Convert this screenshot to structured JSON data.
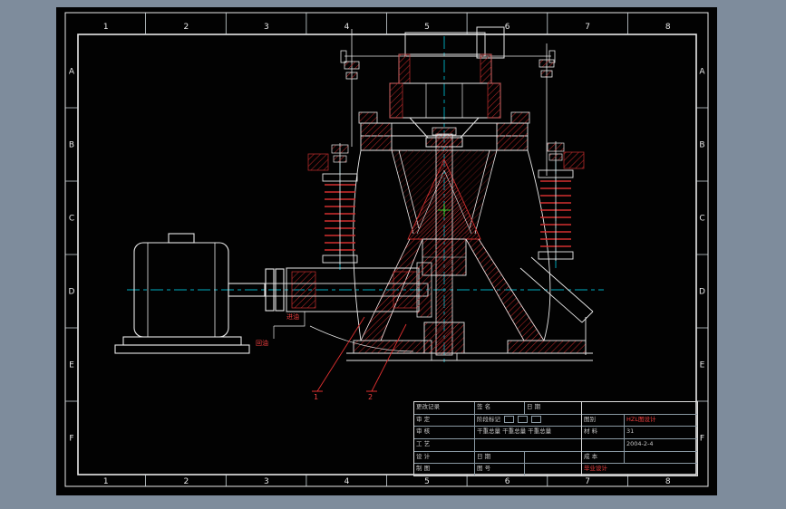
{
  "window": {
    "background": "#7e8c9c",
    "paper_color": "#000000",
    "frame_color": "#e8e8e8",
    "accent_red": "#e03030",
    "accent_cyan": "#00e5ff",
    "accent_green": "#33ff33"
  },
  "zones": {
    "columns": [
      "1",
      "2",
      "3",
      "4",
      "5",
      "6",
      "7",
      "8"
    ],
    "rows": [
      "A",
      "B",
      "C",
      "D",
      "E",
      "F"
    ]
  },
  "labels": {
    "oil_in": "进油",
    "oil_return": "回油",
    "callout_1": "1",
    "callout_2": "2"
  },
  "title_block": {
    "change_record": "更改记录",
    "sign_col": "签 名",
    "date_col": "日 期",
    "row_approve": "审 定",
    "row_check": "审 核",
    "row_process": "工 艺",
    "row_design": "设 计",
    "row_draw": "制 图",
    "stage_mark": "阶段标记",
    "weight_text": "干重总量 干重总量 干重总量",
    "date_label": "日 期",
    "sheet_label": "图 号",
    "code_label": "图别",
    "drawing_code": "HZL图设计",
    "material_label": "材 料",
    "material_value": "31",
    "date_value": "2004-2-4",
    "cost_label": "成 本",
    "company_red": "毕业设计"
  }
}
